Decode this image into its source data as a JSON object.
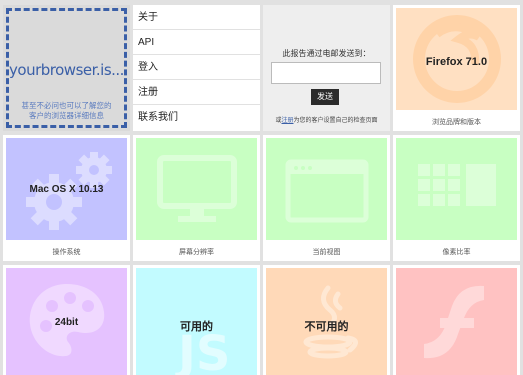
{
  "logo": {
    "text": "yourbrowser.is...",
    "subtitle_line1": "甚至不必问也可以了解您的",
    "subtitle_line2": "客户的浏览器详细信息"
  },
  "menu": {
    "items": [
      {
        "label": "关于"
      },
      {
        "label": "API"
      },
      {
        "label": "登入"
      },
      {
        "label": "注册"
      },
      {
        "label": "联系我们"
      }
    ]
  },
  "email": {
    "title": "此报告通过电邮发送到：",
    "input_value": "",
    "button_label": "发送",
    "note_prefix": "或",
    "note_link": "注册",
    "note_suffix": "为您的客户设置自己的检查页面"
  },
  "tiles": {
    "browser": {
      "value": "Firefox 71.0",
      "label": "浏览品牌和版本",
      "color": "#ffe0c2",
      "icon": "firefox-icon"
    },
    "os": {
      "value": "Mac OS X 10.13",
      "label": "操作系统",
      "color": "#c2c2ff",
      "icon": "gears-icon"
    },
    "resolution": {
      "value": "",
      "label": "屏幕分辨率",
      "color": "#c8ffc2",
      "icon": "monitor-icon"
    },
    "viewport": {
      "value": "",
      "label": "当前视图",
      "color": "#c8ffc2",
      "icon": "browser-window-icon"
    },
    "pixel_ratio": {
      "value": "",
      "label": "像素比率",
      "color": "#c8ffc2",
      "icon": "grid-icon"
    },
    "color_depth": {
      "value": "24bit",
      "label": "",
      "color": "#e5c2ff",
      "icon": "palette-icon"
    },
    "javascript": {
      "value": "可用的",
      "label": "",
      "color": "#c2fbff",
      "icon": "js-icon"
    },
    "java": {
      "value": "不可用的",
      "label": "",
      "color": "#ffd9b8",
      "icon": "java-icon"
    },
    "flash": {
      "value": "",
      "label": "",
      "color": "#ffc2c2",
      "icon": "flash-icon"
    }
  }
}
